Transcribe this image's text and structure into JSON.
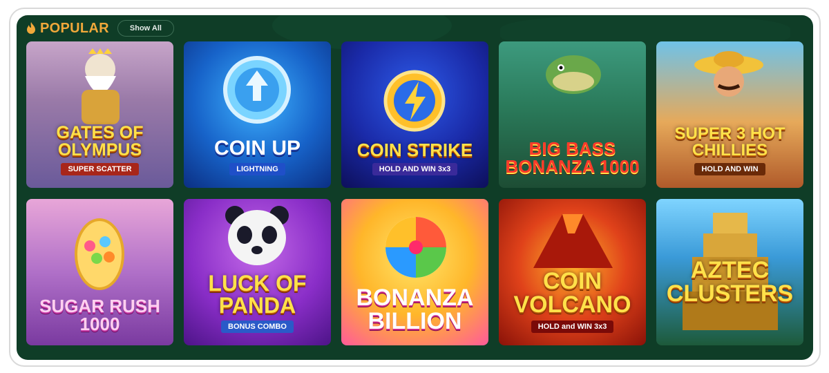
{
  "section": {
    "title": "POPULAR",
    "show_all_label": "Show All"
  },
  "games": [
    {
      "name": "Gates of Olympus",
      "sub": "SUPER SCATTER"
    },
    {
      "name": "Coin Up",
      "sub": "LIGHTNING"
    },
    {
      "name": "Coin Strike",
      "sub": "HOLD AND WIN 3x3"
    },
    {
      "name": "Big Bass Bonanza 1000",
      "sub": ""
    },
    {
      "name": "Super 3 Hot Chillies",
      "sub": "HOLD AND WIN"
    },
    {
      "name": "Sugar Rush 1000",
      "sub": ""
    },
    {
      "name": "Luck of Panda",
      "sub": "BONUS COMBO"
    },
    {
      "name": "Bonanza Billion",
      "sub": ""
    },
    {
      "name": "Coin Volcano",
      "sub": "HOLD and WIN 3x3"
    },
    {
      "name": "Aztec Clusters",
      "sub": ""
    }
  ],
  "colors": {
    "panel_bg": "#0f3d27",
    "title_color": "#f1a83a"
  },
  "icons": {
    "section_icon": "fire-icon"
  }
}
